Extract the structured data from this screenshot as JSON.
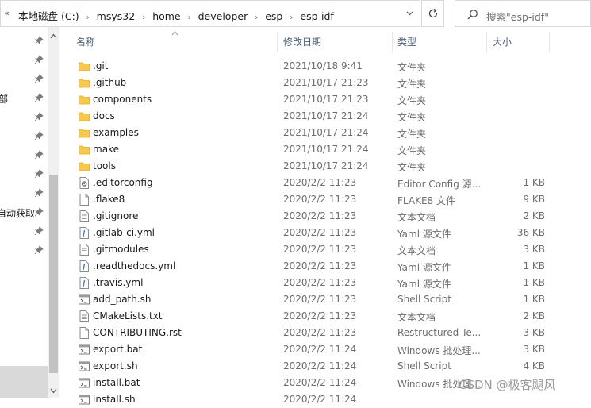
{
  "address": {
    "overflow": "«",
    "crumbs": [
      "本地磁盘 (C:)",
      "msys32",
      "home",
      "developer",
      "esp",
      "esp-idf"
    ]
  },
  "search": {
    "placeholder": "搜索\"esp-idf\""
  },
  "nav": {
    "labels": [
      "部",
      "自动获取"
    ]
  },
  "columns": {
    "name": "名称",
    "date": "修改日期",
    "type": "类型",
    "size": "大小"
  },
  "files": [
    {
      "name": ".git",
      "date": "2021/10/18 9:41",
      "type": "文件夹",
      "size": "",
      "icon": "folder-icon"
    },
    {
      "name": ".github",
      "date": "2021/10/17 21:23",
      "type": "文件夹",
      "size": "",
      "icon": "folder-icon"
    },
    {
      "name": "components",
      "date": "2021/10/17 21:23",
      "type": "文件夹",
      "size": "",
      "icon": "folder-icon"
    },
    {
      "name": "docs",
      "date": "2021/10/17 21:24",
      "type": "文件夹",
      "size": "",
      "icon": "folder-icon"
    },
    {
      "name": "examples",
      "date": "2021/10/17 21:24",
      "type": "文件夹",
      "size": "",
      "icon": "folder-icon"
    },
    {
      "name": "make",
      "date": "2021/10/17 21:24",
      "type": "文件夹",
      "size": "",
      "icon": "folder-icon"
    },
    {
      "name": "tools",
      "date": "2021/10/17 21:24",
      "type": "文件夹",
      "size": "",
      "icon": "folder-icon"
    },
    {
      "name": ".editorconfig",
      "date": "2020/2/2 11:23",
      "type": "Editor Config 源...",
      "size": "1 KB",
      "icon": "config-file-icon"
    },
    {
      "name": ".flake8",
      "date": "2020/2/2 11:23",
      "type": "FLAKE8 文件",
      "size": "9 KB",
      "icon": "blank-file-icon"
    },
    {
      "name": ".gitignore",
      "date": "2020/2/2 11:23",
      "type": "文本文档",
      "size": "2 KB",
      "icon": "text-file-icon"
    },
    {
      "name": ".gitlab-ci.yml",
      "date": "2020/2/2 11:23",
      "type": "Yaml 源文件",
      "size": "36 KB",
      "icon": "yaml-file-icon"
    },
    {
      "name": ".gitmodules",
      "date": "2020/2/2 11:23",
      "type": "文本文档",
      "size": "3 KB",
      "icon": "text-file-icon"
    },
    {
      "name": ".readthedocs.yml",
      "date": "2020/2/2 11:23",
      "type": "Yaml 源文件",
      "size": "1 KB",
      "icon": "yaml-file-icon"
    },
    {
      "name": ".travis.yml",
      "date": "2020/2/2 11:23",
      "type": "Yaml 源文件",
      "size": "1 KB",
      "icon": "yaml-file-icon"
    },
    {
      "name": "add_path.sh",
      "date": "2020/2/2 11:23",
      "type": "Shell Script",
      "size": "1 KB",
      "icon": "script-file-icon"
    },
    {
      "name": "CMakeLists.txt",
      "date": "2020/2/2 11:23",
      "type": "文本文档",
      "size": "2 KB",
      "icon": "text-file-icon"
    },
    {
      "name": "CONTRIBUTING.rst",
      "date": "2020/2/2 11:23",
      "type": "Restructured Te...",
      "size": "3 KB",
      "icon": "blank-file-icon"
    },
    {
      "name": "export.bat",
      "date": "2020/2/2 11:24",
      "type": "Windows 批处理...",
      "size": "3 KB",
      "icon": "script-file-icon"
    },
    {
      "name": "export.sh",
      "date": "2020/2/2 11:24",
      "type": "Shell Script",
      "size": "4 KB",
      "icon": "script-file-icon"
    },
    {
      "name": "install.bat",
      "date": "2020/2/2 11:24",
      "type": "Windows 批处理...",
      "size": "",
      "icon": "script-file-icon"
    },
    {
      "name": "install.sh",
      "date": "2020/2/2 11:24",
      "type": "",
      "size": "",
      "icon": "script-file-icon"
    }
  ],
  "watermark": "CSDN @极客飓风",
  "colors": {
    "folder": "#f6c94c",
    "header_text": "#4c607a",
    "meta_text": "#6d6d6d"
  }
}
